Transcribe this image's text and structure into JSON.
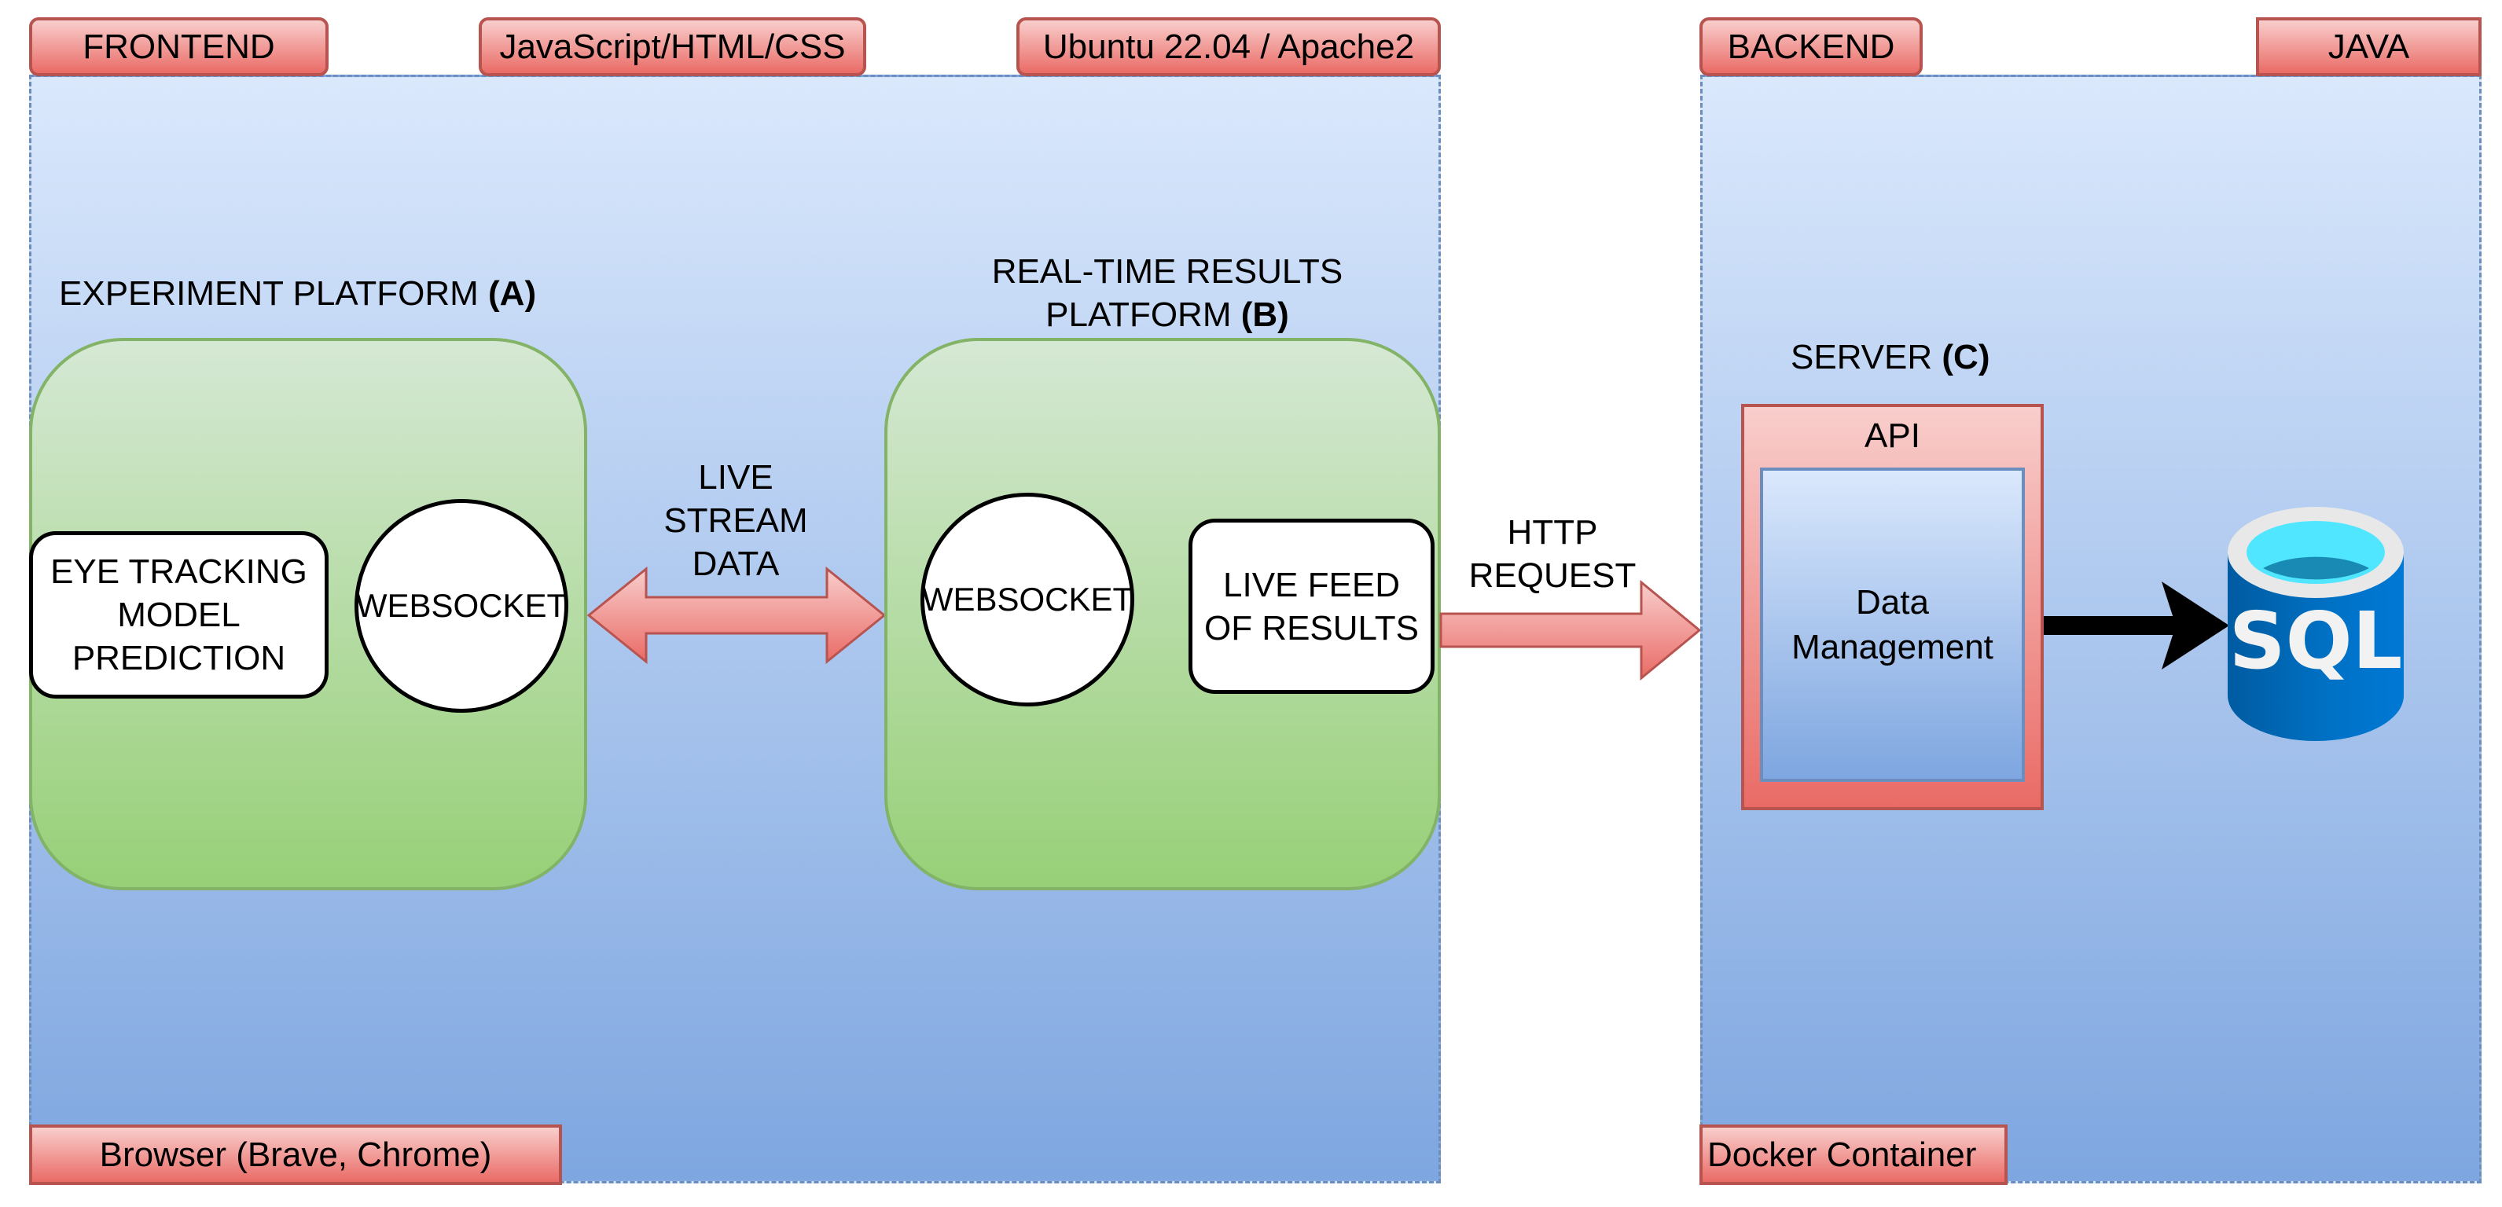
{
  "diagram": {
    "frontend": {
      "tags": {
        "section": "FRONTEND",
        "languages": "JavaScript/HTML/CSS",
        "host": "Ubuntu 22.04 / Apache2",
        "runtime": "Browser (Brave, Chrome)"
      },
      "platform_a": {
        "title": "EXPERIMENT PLATFORM",
        "title_letter": "(A)",
        "model_box": "EYE TRACKING MODEL PREDICTION",
        "model_lines": [
          "EYE TRACKING",
          "MODEL",
          "PREDICTION"
        ],
        "websocket": "WEBSOCKET"
      },
      "link_ab": {
        "lines": [
          "LIVE",
          "STREAM",
          "DATA"
        ]
      },
      "platform_b": {
        "title_line1": "REAL-TIME RESULTS",
        "title_line2": "PLATFORM",
        "title_letter": "(B)",
        "websocket": "WEBSOCKET",
        "feed_lines": [
          "LIVE FEED",
          "OF RESULTS"
        ]
      }
    },
    "link_bc": {
      "lines": [
        "HTTP",
        "REQUEST"
      ]
    },
    "backend": {
      "tags": {
        "section": "BACKEND",
        "language": "JAVA",
        "runtime": "Docker Container"
      },
      "server": {
        "title": "SERVER",
        "title_letter": "(C)",
        "api_label": "API",
        "data_lines": [
          "Data",
          "Management"
        ]
      },
      "database": {
        "icon": "sql-database-icon",
        "label": "SQL"
      }
    },
    "colors": {
      "container_top": "#dae8fc",
      "container_bottom": "#7ea6e0",
      "container_border": "#6c8ebf",
      "tag_top": "#f8cecc",
      "tag_bottom": "#ea6b66",
      "tag_border": "#b85450",
      "platform_top": "#d5e8d4",
      "platform_bottom": "#97d077",
      "platform_border": "#82b366",
      "sql_blue": "#0072c6"
    }
  }
}
